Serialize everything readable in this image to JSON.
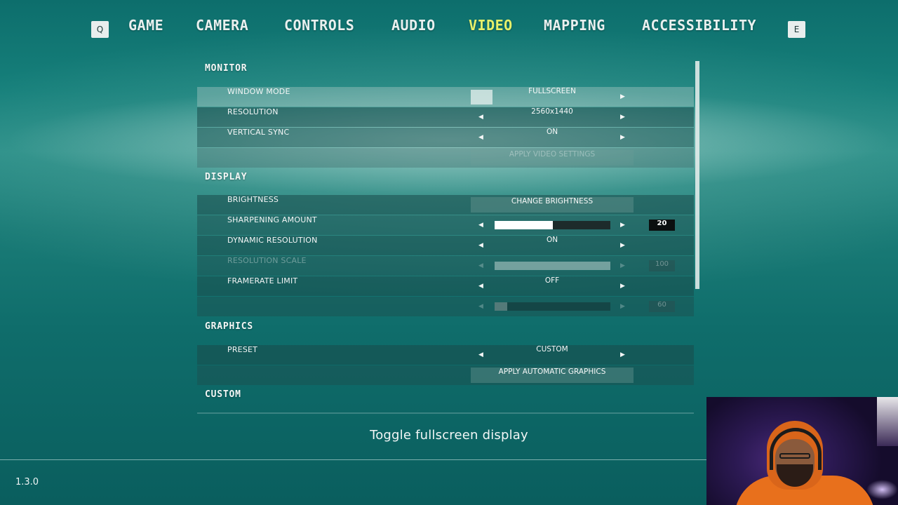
{
  "nav": {
    "prev_key": "Q",
    "next_key": "E",
    "tabs": [
      {
        "label": "GAME"
      },
      {
        "label": "CAMERA"
      },
      {
        "label": "CONTROLS"
      },
      {
        "label": "AUDIO"
      },
      {
        "label": "VIDEO"
      },
      {
        "label": "MAPPING"
      },
      {
        "label": "ACCESSIBILITY"
      }
    ],
    "active_tab": "VIDEO",
    "active_color": "#e6f06a"
  },
  "monitor": {
    "title": "MONITOR",
    "window_mode": {
      "label": "WINDOW MODE",
      "value": "FULLSCREEN"
    },
    "resolution": {
      "label": "RESOLUTION",
      "value": "2560x1440"
    },
    "vertical_sync": {
      "label": "VERTICAL SYNC",
      "value": "ON"
    },
    "apply_button": "APPLY VIDEO SETTINGS"
  },
  "display": {
    "title": "DISPLAY",
    "brightness": {
      "label": "BRIGHTNESS",
      "button": "CHANGE BRIGHTNESS"
    },
    "sharpening": {
      "label": "SHARPENING AMOUNT",
      "value": "20",
      "fill_fraction": 0.5
    },
    "dynamic_resolution": {
      "label": "DYNAMIC RESOLUTION",
      "value": "ON"
    },
    "resolution_scale": {
      "label": "RESOLUTION SCALE",
      "value": "100",
      "fill_fraction": 1.0,
      "enabled": false
    },
    "framerate_limit": {
      "label": "FRAMERATE LIMIT",
      "value": "OFF"
    },
    "framerate_value": {
      "value": "60",
      "fill_fraction": 0.11,
      "enabled": false
    }
  },
  "graphics": {
    "title": "GRAPHICS",
    "preset": {
      "label": "PRESET",
      "value": "CUSTOM"
    },
    "apply_button": "APPLY AUTOMATIC GRAPHICS"
  },
  "custom": {
    "title": "CUSTOM"
  },
  "icons": {
    "left_arrow": "◀",
    "right_arrow": "▶"
  },
  "description": "Toggle fullscreen display",
  "version": "1.3.0"
}
